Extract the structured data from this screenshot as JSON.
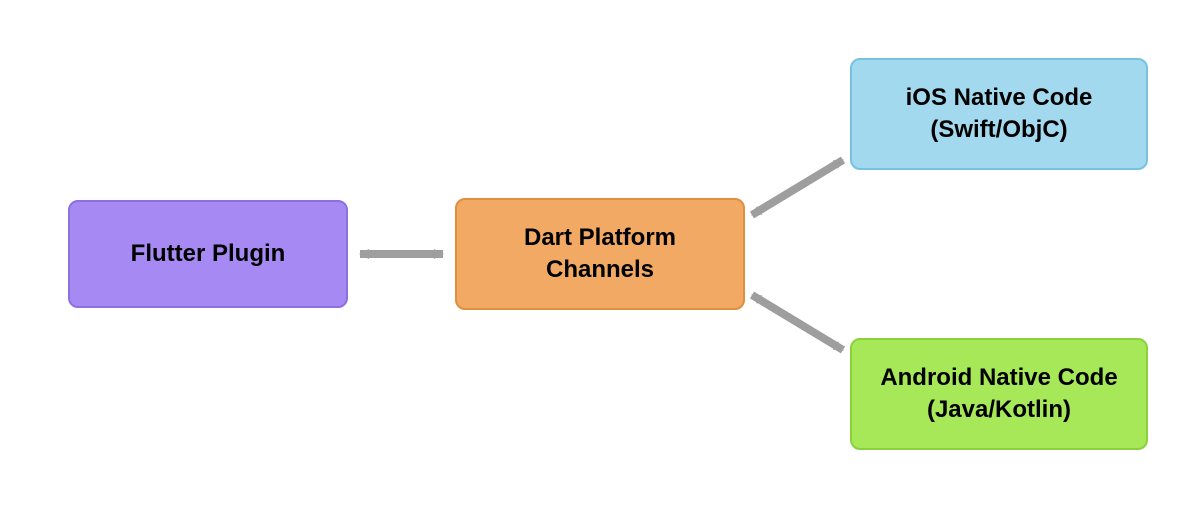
{
  "nodes": {
    "flutter_plugin": "Flutter Plugin",
    "dart_channels": "Dart Platform\nChannels",
    "ios_native": "iOS Native Code\n(Swift/ObjC)",
    "android_native": "Android Native Code\n(Java/Kotlin)"
  },
  "colors": {
    "flutter_plugin": "#a789f4",
    "dart_channels": "#f2a963",
    "ios_native": "#a3d9ee",
    "android_native": "#a6e857",
    "arrow": "#9e9e9e"
  },
  "connections": [
    {
      "from": "flutter_plugin",
      "to": "dart_channels",
      "bidirectional": true
    },
    {
      "from": "dart_channels",
      "to": "ios_native",
      "bidirectional": true
    },
    {
      "from": "dart_channels",
      "to": "android_native",
      "bidirectional": true
    }
  ]
}
